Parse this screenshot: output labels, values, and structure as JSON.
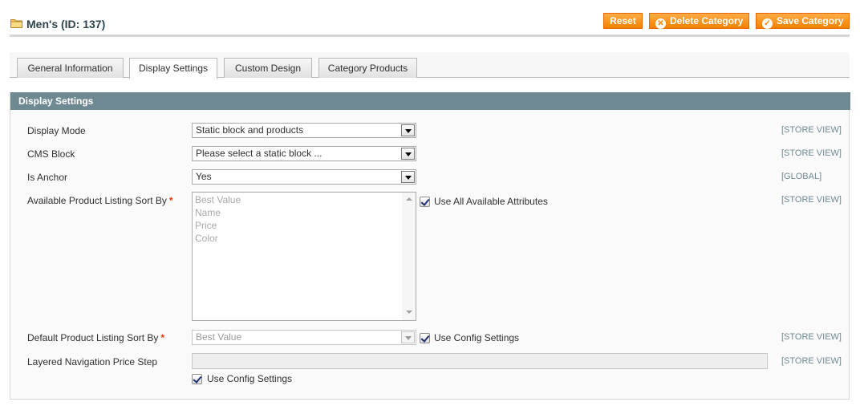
{
  "header": {
    "title": "Men's (ID: 137)",
    "buttons": {
      "reset": "Reset",
      "delete": "Delete Category",
      "save": "Save Category"
    }
  },
  "tabs": [
    {
      "label": "General Information",
      "active": false
    },
    {
      "label": "Display Settings",
      "active": true
    },
    {
      "label": "Custom Design",
      "active": false
    },
    {
      "label": "Category Products",
      "active": false
    }
  ],
  "section": {
    "title": "Display Settings"
  },
  "fields": {
    "display_mode": {
      "label": "Display Mode",
      "value": "Static block and products",
      "scope": "[STORE VIEW]"
    },
    "cms_block": {
      "label": "CMS Block",
      "value": "Please select a static block ...",
      "scope": "[STORE VIEW]"
    },
    "is_anchor": {
      "label": "Is Anchor",
      "value": "Yes",
      "scope": "[GLOBAL]"
    },
    "available_sort_by": {
      "label": "Available Product Listing Sort By",
      "options": [
        "Best Value",
        "Name",
        "Price",
        "Color"
      ],
      "checkbox_label": "Use All Available Attributes",
      "checked": true,
      "scope": "[STORE VIEW]"
    },
    "default_sort_by": {
      "label": "Default Product Listing Sort By",
      "value": "Best Value",
      "checkbox_label": "Use Config Settings",
      "checked": true,
      "scope": "[STORE VIEW]"
    },
    "price_step": {
      "label": "Layered Navigation Price Step",
      "value": "",
      "checkbox_label": "Use Config Settings",
      "checked": true,
      "scope": "[STORE VIEW]"
    }
  },
  "colors": {
    "accent": "#f18200",
    "section_header": "#6f8992",
    "required": "#eb340a"
  }
}
